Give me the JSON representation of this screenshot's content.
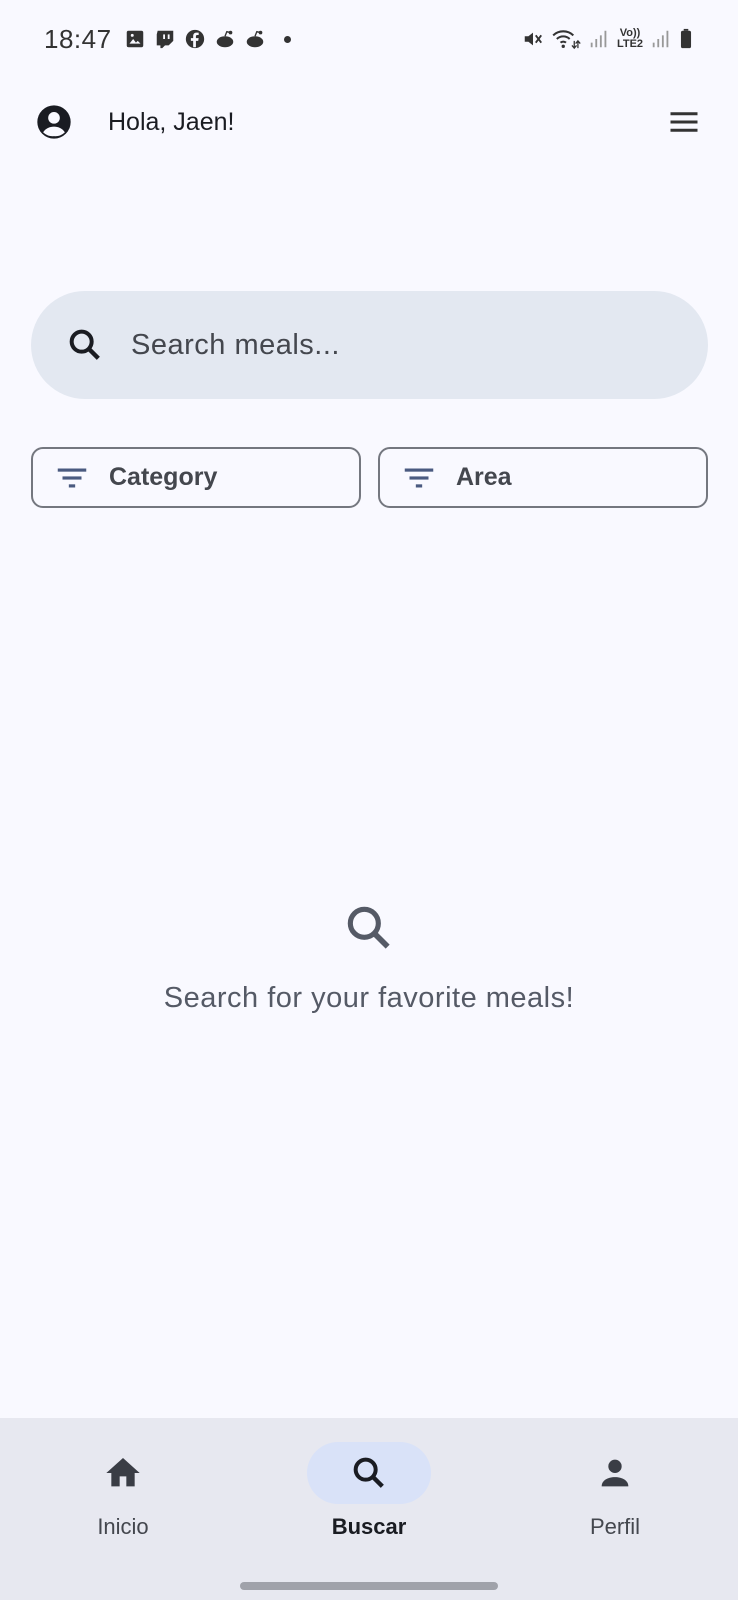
{
  "status_bar": {
    "time": "18:47",
    "notification_icons": [
      "image-icon",
      "twitch-icon",
      "facebook-icon",
      "reddit-icon",
      "reddit-icon"
    ],
    "system_icons": [
      "mute-icon",
      "wifi-icon",
      "signal-icon",
      "volte-lte2-icon",
      "signal-icon",
      "battery-icon"
    ],
    "lte_top": "Vo))",
    "lte_bottom": "LTE2"
  },
  "header": {
    "greeting": "Hola, Jaen!",
    "avatar_icon": "account-circle-icon",
    "menu_icon": "hamburger-menu-icon"
  },
  "search": {
    "placeholder": "Search meals...",
    "value": "",
    "icon": "search-icon"
  },
  "filters": [
    {
      "label": "Category",
      "icon": "filter-icon"
    },
    {
      "label": "Area",
      "icon": "filter-icon"
    }
  ],
  "empty_state": {
    "icon": "search-icon",
    "message": "Search for your favorite meals!"
  },
  "bottom_nav": {
    "items": [
      {
        "label": "Inicio",
        "icon": "home-icon",
        "active": false
      },
      {
        "label": "Buscar",
        "icon": "search-icon",
        "active": true
      },
      {
        "label": "Perfil",
        "icon": "person-icon",
        "active": false
      }
    ]
  },
  "colors": {
    "background": "#f9f9ff",
    "search_bg": "#e3e8f1",
    "nav_bg": "#e7e8f0",
    "active_pill": "#d9e2f8",
    "filter_icon": "#4a5a80",
    "text_primary": "#1a1c22",
    "text_secondary": "#44474e"
  }
}
